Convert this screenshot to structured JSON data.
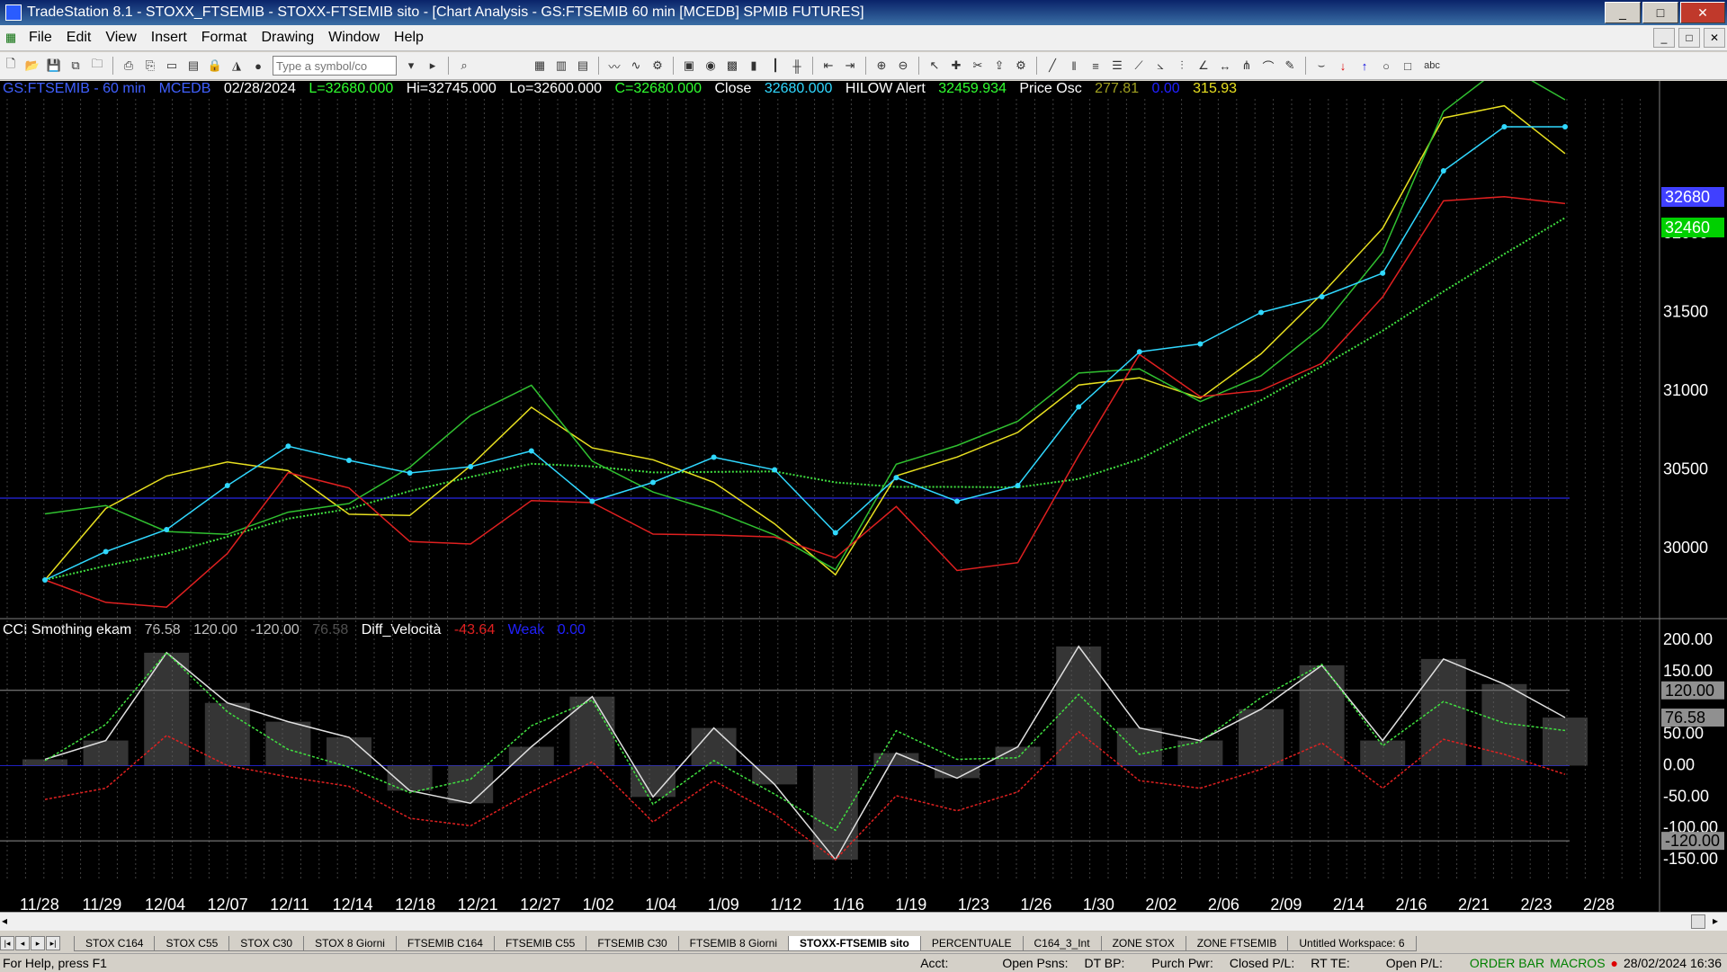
{
  "window": {
    "title": "TradeStation 8.1 - STOXX_FTSEMIB - STOXX-FTSEMIB sito - [Chart Analysis - GS:FTSEMIB  60 min  [MCEDB] SPMIB FUTURES]",
    "minimize": "_",
    "maximize": "□",
    "close": "✕"
  },
  "menu": {
    "items": [
      "File",
      "Edit",
      "View",
      "Insert",
      "Format",
      "Drawing",
      "Window",
      "Help"
    ]
  },
  "toolbar": {
    "symbol_placeholder": "Type a symbol/co",
    "abc_label": "abc"
  },
  "chart": {
    "price_header": {
      "symbol": "GS:FTSEMIB - 60 min",
      "exchange": "MCEDB",
      "date": "02/28/2024",
      "last": "L=32680.000",
      "high": "Hi=32745.000",
      "low": "Lo=32600.000",
      "close": "C=32680.000",
      "close_label": "Close",
      "close_value": "32680.000",
      "alert_label": "HILOW Alert",
      "alert_value": "32459.934",
      "osc_label": "Price Osc",
      "osc_v1": "277.81",
      "osc_v2": "0.00",
      "osc_v3": "315.93"
    },
    "osc_header": {
      "name": "CCI Smothing ekam",
      "v1": "76.58",
      "v2": "120.00",
      "v3": "-120.00",
      "v4": "76.58",
      "diff_label": "Diff_Velocità",
      "diff_value": "-43.64",
      "weak_label": "Weak",
      "weak_value": "0.00"
    },
    "price_axis": [
      "32000",
      "31500",
      "31000",
      "30500",
      "30000"
    ],
    "price_markers": [
      {
        "text": "32680",
        "color": "#4040ff"
      },
      {
        "text": "32460",
        "color": "#00d000"
      }
    ],
    "osc_axis": [
      "200.00",
      "150.00",
      "50.00",
      "0.00",
      "-50.00",
      "-100.00",
      "-150.00"
    ],
    "osc_markers": [
      "120.00",
      "76.58",
      "-120.00"
    ],
    "dates": [
      "11/28",
      "11/29",
      "12/04",
      "12/07",
      "12/11",
      "12/14",
      "12/18",
      "12/21",
      "12/27",
      "1/02",
      "1/04",
      "1/09",
      "1/12",
      "1/16",
      "1/19",
      "1/23",
      "1/26",
      "1/30",
      "2/02",
      "2/06",
      "2/09",
      "2/14",
      "2/16",
      "2/21",
      "2/23",
      "2/28"
    ],
    "colors": {
      "price": "#30d8ff",
      "red": "#e02020",
      "yellow": "#e8e020",
      "green": "#30c030",
      "dotted_green": "#40e040",
      "blue": "#2020c0"
    }
  },
  "chart_data": {
    "type": "line",
    "x": [
      "11/28",
      "11/29",
      "12/04",
      "12/07",
      "12/11",
      "12/14",
      "12/18",
      "12/21",
      "12/27",
      "1/02",
      "1/04",
      "1/09",
      "1/12",
      "1/16",
      "1/19",
      "1/23",
      "1/26",
      "1/30",
      "2/02",
      "2/06",
      "2/09",
      "2/14",
      "2/16",
      "2/21",
      "2/23",
      "2/28"
    ],
    "series": [
      {
        "name": "Close",
        "values": [
          29800,
          29980,
          30120,
          30400,
          30650,
          30560,
          30480,
          30520,
          30620,
          30300,
          30420,
          30580,
          30500,
          30100,
          30450,
          30300,
          30400,
          30900,
          31250,
          31300,
          31500,
          31600,
          31750,
          32400,
          32680,
          32680
        ]
      }
    ],
    "ylim": [
      29600,
      32800
    ],
    "indicator": {
      "name": "CCI Smothing ekam",
      "values": [
        10,
        40,
        180,
        100,
        70,
        45,
        -40,
        -60,
        30,
        110,
        -50,
        60,
        -30,
        -150,
        20,
        -20,
        30,
        190,
        60,
        40,
        90,
        160,
        40,
        170,
        130,
        76.58
      ],
      "ylim": [
        -170,
        210
      ],
      "levels": [
        120,
        -120,
        0
      ]
    }
  },
  "tabs": {
    "items": [
      "STOX C164",
      "STOX C55",
      "STOX  C30",
      "STOX  8 Giorni",
      "FTSEMIB C164",
      "FTSEMIB C55",
      "FTSEMIB C30",
      "FTSEMIB  8 Giorni",
      "STOXX-FTSEMIB sito",
      "PERCENTUALE",
      "C164_3_Int",
      "ZONE STOX",
      "ZONE FTSEMIB",
      "Untitled Workspace:  6"
    ],
    "active": 8
  },
  "status": {
    "help": "For Help, press F1",
    "acct": "Acct:",
    "open_psns": "Open Psns:",
    "dt_bp": "DT BP:",
    "purch_pwr": "Purch Pwr:",
    "closed_pl": "Closed P/L:",
    "rt_te": "RT TE:",
    "open_pl": "Open P/L:",
    "order_bar": "ORDER BAR",
    "macros": "MACROS",
    "datetime": "28/02/2024 16:36"
  }
}
